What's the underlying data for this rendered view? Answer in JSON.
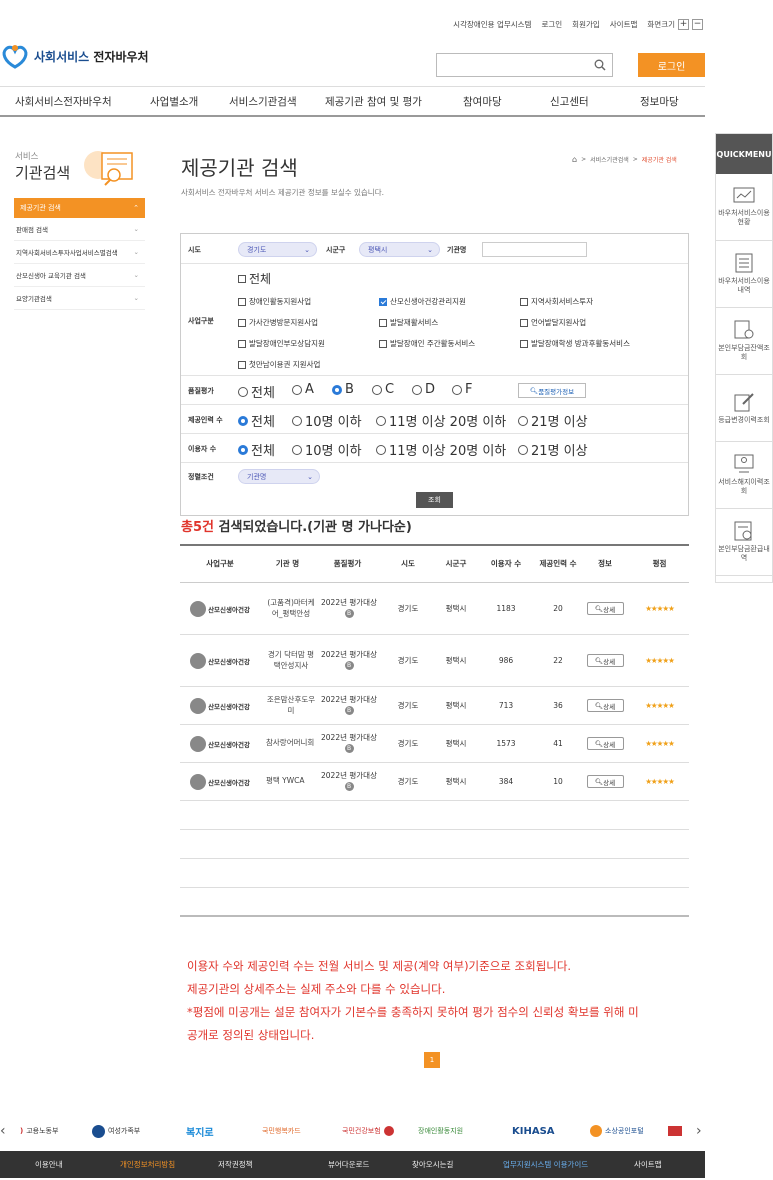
{
  "util": {
    "items": [
      "시각장애인용 업무시스템",
      "로그인",
      "회원가입",
      "사이트맵"
    ],
    "zoom_label": "화면크기",
    "zoom_in": "+",
    "zoom_out": "−"
  },
  "logo": {
    "part1": "사회서비스",
    "part2": "전자바우처"
  },
  "header": {
    "login": "로그인"
  },
  "gnb": [
    "사회서비스전자바우처",
    "사업별소개",
    "서비스기관검색",
    "제공기관 참여 및 평가",
    "참여마당",
    "신고센터",
    "정보마당"
  ],
  "quick": {
    "title": "QUICKMENU",
    "items": [
      "바우처서비스이용현황",
      "바우처서비스이용내역",
      "본인부담금잔액조회",
      "등급변경이력조회",
      "서비스해지이력조회",
      "본인부담금환급내역"
    ]
  },
  "side": {
    "small": "서비스",
    "big": "기관검색",
    "active": "제공기관 검색",
    "items": [
      "판매점 검색",
      "지역사회서비스투자사업서비스별검색",
      "산모신생아 교육기관 검색",
      "요양기관검색"
    ]
  },
  "page": {
    "title": "제공기관 검색",
    "subtitle": "사회서비스 전자바우처 서비스 제공기관 정보를 보실수 있습니다.",
    "bc_sep": ">",
    "bc1": "서비스기관검색",
    "bc2": "제공기관 검색"
  },
  "filter": {
    "sido_label": "시도",
    "sido": "경기도",
    "sigungu_label": "시군구",
    "sigungu": "평택시",
    "org_label": "기관명",
    "biz_label": "사업구분",
    "all": "전체",
    "biz": [
      "장애인활동지원사업",
      "산모신생아건강관리지원",
      "지역사회서비스투자",
      "가사간병방문지원사업",
      "발달재활서비스",
      "언어발달지원사업",
      "발달장애인부모상담지원",
      "발달장애인 주간활동서비스",
      "발달장애학생 방과후활동서비스",
      "첫만남이용권 지원사업"
    ],
    "quality_label": "품질평가",
    "quality": [
      "전체",
      "A",
      "B",
      "C",
      "D",
      "F"
    ],
    "quality_btn": "품질평가정보",
    "staff_label": "제공인력 수",
    "staff": [
      "전체",
      "10명 이하",
      "11명 이상 20명 이하",
      "21명 이상"
    ],
    "users_label": "이용자 수",
    "users": [
      "전체",
      "10명 이하",
      "11명 이상 20명 이하",
      "21명 이상"
    ],
    "sort_label": "정렬조건",
    "sort": "기관명",
    "search": "조회"
  },
  "result": {
    "count": "총5건",
    "text": " 검색되었습니다.(기관 명 가나다순)"
  },
  "table": {
    "headers": [
      "사업구분",
      "기관 명",
      "품질평가",
      "시도",
      "시군구",
      "이용자 수",
      "제공인력 수",
      "정보",
      "평점"
    ],
    "rows": [
      {
        "cat": "산모신생아건강",
        "name": "(고품격)마터케어_평택안성",
        "eval": "2022년 평가대상",
        "grade": "B",
        "sido": "경기도",
        "sigungu": "평택시",
        "users": "1183",
        "staff": "20",
        "detail": "상세",
        "stars": "★★★★★"
      },
      {
        "cat": "산모신생아건강",
        "name": "경기 닥터맘 평택안성지사",
        "eval": "2022년 평가대상",
        "grade": "B",
        "sido": "경기도",
        "sigungu": "평택시",
        "users": "986",
        "staff": "22",
        "detail": "상세",
        "stars": "★★★★★"
      },
      {
        "cat": "산모신생아건강",
        "name": "조은맘산후도우미",
        "eval": "2022년 평가대상",
        "grade": "B",
        "sido": "경기도",
        "sigungu": "평택시",
        "users": "713",
        "staff": "36",
        "detail": "상세",
        "stars": "★★★★★"
      },
      {
        "cat": "산모신생아건강",
        "name": "참사랑어머니회",
        "eval": "2022년 평가대상",
        "grade": "B",
        "sido": "경기도",
        "sigungu": "평택시",
        "users": "1573",
        "staff": "41",
        "detail": "상세",
        "stars": "★★★★★"
      },
      {
        "cat": "산모신생아건강",
        "name": "평택 YWCA",
        "eval": "2022년 평가대상",
        "grade": "B",
        "sido": "경기도",
        "sigungu": "평택시",
        "users": "384",
        "staff": "10",
        "detail": "상세",
        "stars": "★★★★★"
      }
    ]
  },
  "notes": [
    "이용자 수와 제공인력 수는 전월 서비스 및 제공(계약 여부)기준으로 조회됩니다.",
    "제공기관의 상세주소는 실제 주소와 다를 수 있습니다.",
    "*평점에 미공개는 설문 참여자가 기본수를 충족하지 못하여 평가 점수의 신뢰성 확보를 위해 미",
    "공개로 정의된 상태입니다."
  ],
  "pagination": {
    "current": "1"
  },
  "partners": [
    "고용노동부",
    "여성가족부",
    "복지로",
    "국민행복카드",
    "국민건강보험",
    "장애인활동지원",
    "KIHASA",
    "소상공인포털"
  ],
  "footer": [
    "이용안내",
    "개인정보처리방침",
    "저작권정책",
    "뷰어다운로드",
    "찾아오시는길",
    "업무지원시스템 이용가이드",
    "사이트맵"
  ],
  "colors": {
    "accent": "#f39224",
    "red": "#e0342b",
    "blue": "#2a7ad8"
  }
}
